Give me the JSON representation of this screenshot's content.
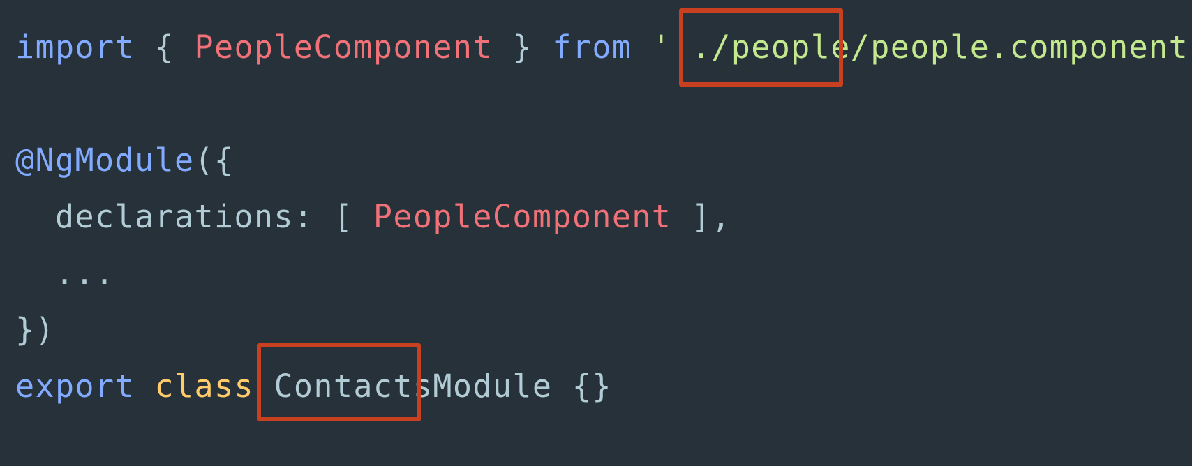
{
  "code": {
    "line1": {
      "kw_import": "import",
      "brace_open": " { ",
      "ident": "PeopleComponent",
      "brace_close": " } ",
      "kw_from": "from",
      "space": " ",
      "str_prefix": "'..",
      "str_highlight": "/people/",
      "str_suffix": "people.component",
      "semi": ";"
    },
    "line2": {
      "decorator": "@NgModule",
      "paren": "({"
    },
    "line3": {
      "indent": "  ",
      "prop": "declarations",
      "colon_bracket": ": [ ",
      "ident": "PeopleComponent",
      "close": " ],"
    },
    "line4": {
      "text": "  ..."
    },
    "line5": {
      "text": "})"
    },
    "line6": {
      "kw_export": "export",
      "space1": " ",
      "kw_class": "class",
      "space2": " ",
      "cls_highlight": "Contacts",
      "cls_rest": "Module",
      "braces": " {}"
    }
  },
  "highlights": [
    {
      "label": "/people/",
      "color": "#c8401f"
    },
    {
      "label": "Contacts",
      "color": "#c8401f"
    }
  ],
  "theme": {
    "background": "#27313a",
    "keyword": "#82aaff",
    "identifier": "#f07178",
    "string": "#c3e88d",
    "storage": "#ffcb6b",
    "plain": "#b2ccd6"
  }
}
